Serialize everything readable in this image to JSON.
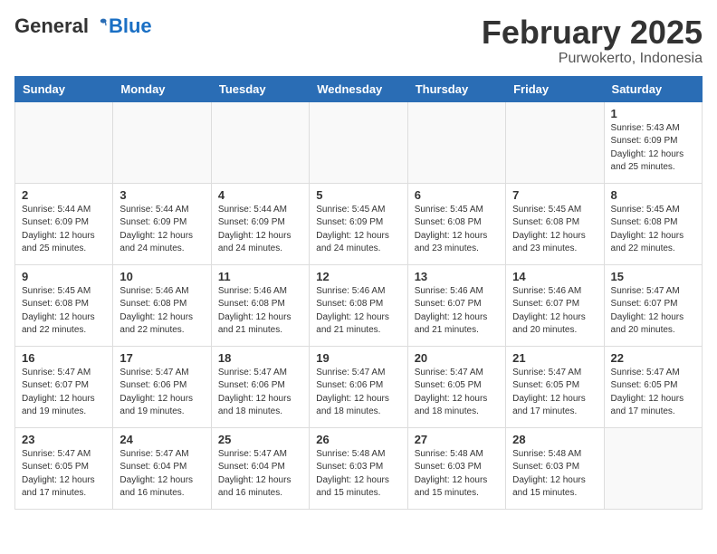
{
  "header": {
    "logo_general": "General",
    "logo_blue": "Blue",
    "month_title": "February 2025",
    "location": "Purwokerto, Indonesia"
  },
  "days_of_week": [
    "Sunday",
    "Monday",
    "Tuesday",
    "Wednesday",
    "Thursday",
    "Friday",
    "Saturday"
  ],
  "weeks": [
    [
      {
        "day": "",
        "info": ""
      },
      {
        "day": "",
        "info": ""
      },
      {
        "day": "",
        "info": ""
      },
      {
        "day": "",
        "info": ""
      },
      {
        "day": "",
        "info": ""
      },
      {
        "day": "",
        "info": ""
      },
      {
        "day": "1",
        "info": "Sunrise: 5:43 AM\nSunset: 6:09 PM\nDaylight: 12 hours\nand 25 minutes."
      }
    ],
    [
      {
        "day": "2",
        "info": "Sunrise: 5:44 AM\nSunset: 6:09 PM\nDaylight: 12 hours\nand 25 minutes."
      },
      {
        "day": "3",
        "info": "Sunrise: 5:44 AM\nSunset: 6:09 PM\nDaylight: 12 hours\nand 24 minutes."
      },
      {
        "day": "4",
        "info": "Sunrise: 5:44 AM\nSunset: 6:09 PM\nDaylight: 12 hours\nand 24 minutes."
      },
      {
        "day": "5",
        "info": "Sunrise: 5:45 AM\nSunset: 6:09 PM\nDaylight: 12 hours\nand 24 minutes."
      },
      {
        "day": "6",
        "info": "Sunrise: 5:45 AM\nSunset: 6:08 PM\nDaylight: 12 hours\nand 23 minutes."
      },
      {
        "day": "7",
        "info": "Sunrise: 5:45 AM\nSunset: 6:08 PM\nDaylight: 12 hours\nand 23 minutes."
      },
      {
        "day": "8",
        "info": "Sunrise: 5:45 AM\nSunset: 6:08 PM\nDaylight: 12 hours\nand 22 minutes."
      }
    ],
    [
      {
        "day": "9",
        "info": "Sunrise: 5:45 AM\nSunset: 6:08 PM\nDaylight: 12 hours\nand 22 minutes."
      },
      {
        "day": "10",
        "info": "Sunrise: 5:46 AM\nSunset: 6:08 PM\nDaylight: 12 hours\nand 22 minutes."
      },
      {
        "day": "11",
        "info": "Sunrise: 5:46 AM\nSunset: 6:08 PM\nDaylight: 12 hours\nand 21 minutes."
      },
      {
        "day": "12",
        "info": "Sunrise: 5:46 AM\nSunset: 6:08 PM\nDaylight: 12 hours\nand 21 minutes."
      },
      {
        "day": "13",
        "info": "Sunrise: 5:46 AM\nSunset: 6:07 PM\nDaylight: 12 hours\nand 21 minutes."
      },
      {
        "day": "14",
        "info": "Sunrise: 5:46 AM\nSunset: 6:07 PM\nDaylight: 12 hours\nand 20 minutes."
      },
      {
        "day": "15",
        "info": "Sunrise: 5:47 AM\nSunset: 6:07 PM\nDaylight: 12 hours\nand 20 minutes."
      }
    ],
    [
      {
        "day": "16",
        "info": "Sunrise: 5:47 AM\nSunset: 6:07 PM\nDaylight: 12 hours\nand 19 minutes."
      },
      {
        "day": "17",
        "info": "Sunrise: 5:47 AM\nSunset: 6:06 PM\nDaylight: 12 hours\nand 19 minutes."
      },
      {
        "day": "18",
        "info": "Sunrise: 5:47 AM\nSunset: 6:06 PM\nDaylight: 12 hours\nand 18 minutes."
      },
      {
        "day": "19",
        "info": "Sunrise: 5:47 AM\nSunset: 6:06 PM\nDaylight: 12 hours\nand 18 minutes."
      },
      {
        "day": "20",
        "info": "Sunrise: 5:47 AM\nSunset: 6:05 PM\nDaylight: 12 hours\nand 18 minutes."
      },
      {
        "day": "21",
        "info": "Sunrise: 5:47 AM\nSunset: 6:05 PM\nDaylight: 12 hours\nand 17 minutes."
      },
      {
        "day": "22",
        "info": "Sunrise: 5:47 AM\nSunset: 6:05 PM\nDaylight: 12 hours\nand 17 minutes."
      }
    ],
    [
      {
        "day": "23",
        "info": "Sunrise: 5:47 AM\nSunset: 6:05 PM\nDaylight: 12 hours\nand 17 minutes."
      },
      {
        "day": "24",
        "info": "Sunrise: 5:47 AM\nSunset: 6:04 PM\nDaylight: 12 hours\nand 16 minutes."
      },
      {
        "day": "25",
        "info": "Sunrise: 5:47 AM\nSunset: 6:04 PM\nDaylight: 12 hours\nand 16 minutes."
      },
      {
        "day": "26",
        "info": "Sunrise: 5:48 AM\nSunset: 6:03 PM\nDaylight: 12 hours\nand 15 minutes."
      },
      {
        "day": "27",
        "info": "Sunrise: 5:48 AM\nSunset: 6:03 PM\nDaylight: 12 hours\nand 15 minutes."
      },
      {
        "day": "28",
        "info": "Sunrise: 5:48 AM\nSunset: 6:03 PM\nDaylight: 12 hours\nand 15 minutes."
      },
      {
        "day": "",
        "info": ""
      }
    ]
  ]
}
